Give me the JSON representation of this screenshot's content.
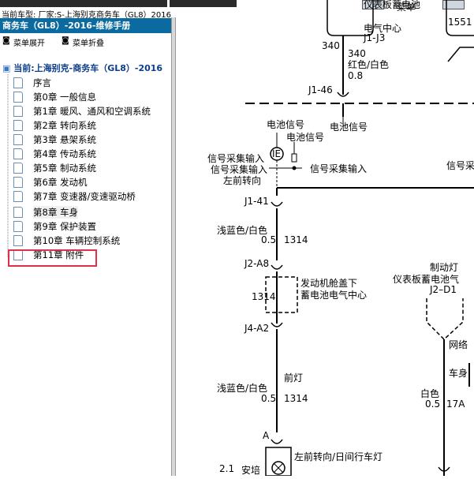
{
  "top": {
    "vehicle_info": "当前车型:  厂家:S-上海别克商务车（GL8）2016",
    "menu_label": "菜单"
  },
  "sidebar": {
    "title": "商务车（GL8）-2016-维修手册",
    "expand_label": "菜单展开",
    "collapse_label": "菜单折叠",
    "current_node": "当前:上海别克-商务车（GL8）-2016",
    "items": [
      {
        "label": "序言"
      },
      {
        "label": "第0章 一般信息"
      },
      {
        "label": "第1章 暖风、通风和空调系统"
      },
      {
        "label": "第2章 转向系统"
      },
      {
        "label": "第3章 悬架系统"
      },
      {
        "label": "第4章 传动系统"
      },
      {
        "label": "第5章 制动系统"
      },
      {
        "label": "第6章 发动机"
      },
      {
        "label": "第7章 变速器/变速驱动桥"
      },
      {
        "label": "第8章 车身",
        "selected": true
      },
      {
        "label": "第9章 保护装置"
      },
      {
        "label": "第10章 车辆控制系统"
      },
      {
        "label": "第11章 附件"
      }
    ]
  },
  "diagram": {
    "t_instrument_top": "仪表板蓄电池",
    "t_elec_center_top": "电气中心",
    "t_j1j3": "J1-J3",
    "t_340a": "340",
    "t_340b": "340",
    "t_red_white": "红色/白色",
    "t_08": "0.8",
    "t_1551": "1551",
    "t_j146": "J1-46",
    "t_battery_signal_1": "电池信号",
    "t_battery_signal_2": "电池信号",
    "t_battery_signal_3": "电池信号",
    "t_sig_in_1": "信号采集输入",
    "t_sig_in_2": "信号采集输入",
    "t_sig_in_3": "信号采集输入",
    "t_sig_in_right": "信号采",
    "t_left_turn": "左前转向",
    "t_j141": "J1-41",
    "t_light_blue_white_1": "浅蓝色/白色",
    "t_05_1": "0.5",
    "t_1314_1": "1314",
    "t_j2a8": "J2-A8",
    "t_engine_cover": "发动机舱盖下",
    "t_battery_center": "蓄电池电气中心",
    "t_1314_box": "1314",
    "t_j4a2": "J4-A2",
    "t_front_lamp": "前灯",
    "t_light_blue_white_2": "浅蓝色/白色",
    "t_05_2": "0.5",
    "t_1314_2": "1314",
    "t_a": "A",
    "t_left_turn_drl": "左前转向/日间行车灯",
    "t_21": "2.1",
    "t_install": "安培",
    "t_brake_light": "制动灯",
    "t_instrument_battery": "仪表板蓄电池气",
    "t_j2d1": "J2–D1",
    "t_network": "网络",
    "t_body": "车身",
    "t_white": "白色",
    "t_05_3": "0.5",
    "t_17a": "17A"
  }
}
